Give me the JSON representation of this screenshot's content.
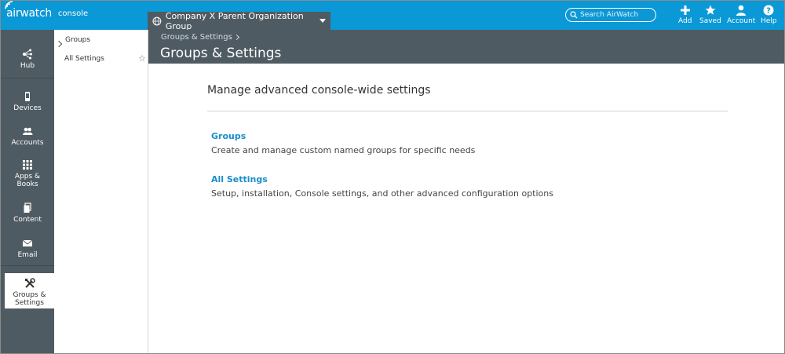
{
  "brand": {
    "logo_text": "airwatch",
    "product": "console"
  },
  "org_group": {
    "label": "Company X Parent Organization Group"
  },
  "search": {
    "placeholder": "Search AirWatch"
  },
  "top_actions": [
    {
      "label": "Add",
      "icon": "plus-icon"
    },
    {
      "label": "Saved",
      "icon": "star-icon"
    },
    {
      "label": "Account",
      "icon": "user-icon"
    },
    {
      "label": "Help",
      "icon": "help-icon"
    }
  ],
  "left_nav": [
    {
      "label": "Hub",
      "icon": "hub-icon"
    },
    {
      "label": "Devices",
      "icon": "device-icon"
    },
    {
      "label": "Accounts",
      "icon": "accounts-icon"
    },
    {
      "label": "Apps & Books",
      "icon": "apps-grid-icon"
    },
    {
      "label": "Content",
      "icon": "content-icon"
    },
    {
      "label": "Email",
      "icon": "email-icon"
    },
    {
      "label": "Groups & Settings",
      "icon": "tools-icon",
      "active": true
    }
  ],
  "sub_nav": [
    {
      "label": "Groups"
    },
    {
      "label": "All Settings"
    }
  ],
  "header": {
    "breadcrumb": "Groups & Settings",
    "title": "Groups & Settings"
  },
  "main": {
    "heading": "Manage advanced console-wide settings",
    "sections": [
      {
        "title": "Groups",
        "description": "Create and manage custom named groups for specific needs"
      },
      {
        "title": "All Settings",
        "description": "Setup, installation, Console settings, and other advanced configuration options"
      }
    ]
  },
  "colors": {
    "topbar": "#0b98d6",
    "nav": "#4f5b62",
    "link": "#1a8ec9"
  }
}
